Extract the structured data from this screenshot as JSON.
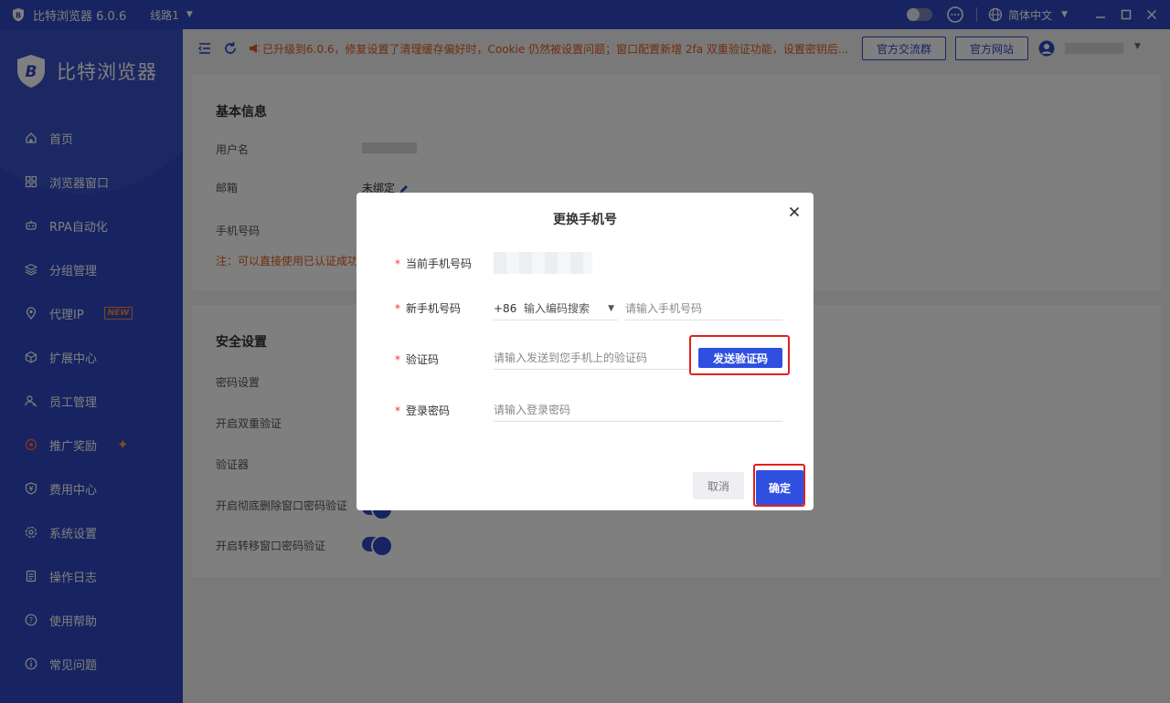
{
  "titlebar": {
    "app_title": "比特浏览器 6.0.6",
    "route": "线路1",
    "language": "简体中文"
  },
  "sidebar": {
    "brand": "比特浏览器",
    "items": [
      {
        "label": "首页",
        "icon": "home-icon"
      },
      {
        "label": "浏览器窗口",
        "icon": "grid-icon"
      },
      {
        "label": "RPA自动化",
        "icon": "robot-icon"
      },
      {
        "label": "分组管理",
        "icon": "layers-icon"
      },
      {
        "label": "代理IP",
        "icon": "location-pin-icon",
        "badge": "NEW"
      },
      {
        "label": "扩展中心",
        "icon": "cube-icon"
      },
      {
        "label": "员工管理",
        "icon": "users-icon"
      },
      {
        "label": "推广奖励",
        "icon": "gift-icon"
      },
      {
        "label": "费用中心",
        "icon": "shield-yen-icon"
      },
      {
        "label": "系统设置",
        "icon": "gear-icon"
      },
      {
        "label": "操作日志",
        "icon": "log-icon"
      },
      {
        "label": "使用帮助",
        "icon": "help-circle-icon"
      },
      {
        "label": "常见问题",
        "icon": "info-circle-icon"
      }
    ]
  },
  "toolbar": {
    "notice": "已升级到6.0.6，修复设置了清理缓存偏好时，Cookie 仍然被设置问题；窗口配置新增 2fa 双重验证功能，设置密钥后...",
    "group_button": "官方交流群",
    "site_button": "官方网站"
  },
  "basic_info": {
    "title": "基本信息",
    "username_label": "用户名",
    "email_label": "邮箱",
    "email_value": "未绑定",
    "phone_label": "手机号码",
    "note": "注：可以直接使用已认证成功"
  },
  "security": {
    "title": "安全设置",
    "rows": [
      "密码设置",
      "开启双重验证",
      "验证器",
      "开启彻底删除窗口密码验证",
      "开启转移窗口密码验证"
    ]
  },
  "modal": {
    "title": "更换手机号",
    "current_phone_label": "当前手机号码",
    "new_phone_label": "新手机号码",
    "country_code": "+86",
    "country_search_placeholder": "输入编码搜索",
    "phone_placeholder": "请输入手机号码",
    "code_label": "验证码",
    "code_placeholder": "请输入发送到您手机上的验证码",
    "send_code": "发送验证码",
    "password_label": "登录密码",
    "password_placeholder": "请输入登录密码",
    "cancel": "取消",
    "confirm": "确定"
  },
  "colors": {
    "brand": "#2f49c2",
    "accent_button": "#2f4fe0",
    "notice": "#e05a1a",
    "highlight": "#e02020"
  }
}
